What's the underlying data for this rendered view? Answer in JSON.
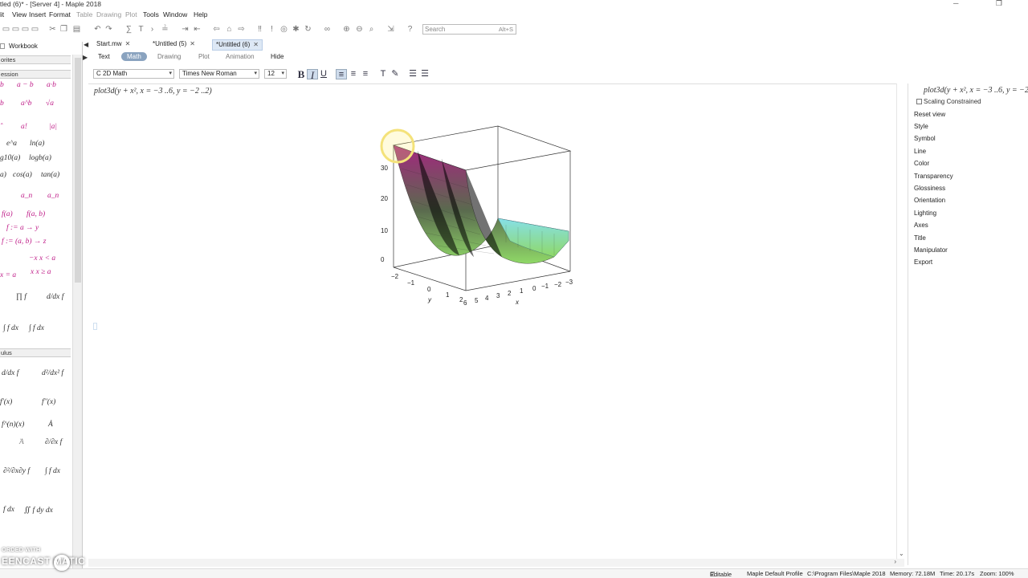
{
  "window": {
    "title": "itled (6)* - [Server 4] - Maple 2018",
    "buttons": [
      "minimize",
      "restore"
    ]
  },
  "menu": [
    "lit",
    "View",
    "Insert",
    "Format",
    "Table",
    "Drawing",
    "Plot",
    "Tools",
    "Window",
    "Help"
  ],
  "search": {
    "placeholder": "Search",
    "shortcut": "Alt+S"
  },
  "left_panel": {
    "tabs": [
      "Workbook"
    ],
    "sections": {
      "favorites": "orites",
      "expression": "ession",
      "calculus": "ulus"
    },
    "palette": {
      "r1": [
        "b",
        "a − b",
        "a·b"
      ],
      "r2": [
        "b",
        "a^b",
        "√a"
      ],
      "r3": [
        "ˆ",
        "a!",
        "|a|"
      ],
      "r4": [
        "e^a",
        "ln(a)"
      ],
      "r5": [
        "g10(a)",
        "logb(a)"
      ],
      "r6": [
        "a)",
        "cos(a)",
        "tan(a)"
      ],
      "r7": [
        "a_n",
        "a_n"
      ],
      "r8": [
        "f(a)",
        "f(a, b)"
      ],
      "r9": [
        "f := a → y"
      ],
      "r10": [
        "f := (a, b) → z"
      ],
      "r11": [
        "−x  x < a",
        "x  x ≥ a",
        "x = a"
      ],
      "r12": [
        "∏ f",
        "d/dx f"
      ],
      "r13": [
        "∫ f dx",
        "∫ f dx"
      ],
      "c1": [
        "d/dx f",
        "d²/dx² f"
      ],
      "c2": [
        "f′(x)",
        "f′′(x)"
      ],
      "c3": [
        "f^(n)(x)",
        "Ȧ"
      ],
      "c4": [
        "̈A",
        "∂/∂x f"
      ],
      "c5": [
        "∂²/∂x∂y f",
        "∫ f dx"
      ],
      "c6": [
        "f dx",
        "∬ f dy dx"
      ]
    }
  },
  "doc_tabs": [
    {
      "label": "Start.mw"
    },
    {
      "label": "*Untitled (5)"
    },
    {
      "label": "*Untitled (6)"
    }
  ],
  "context_bar": {
    "text": "Text",
    "math": "Math",
    "drawing": "Drawing",
    "plot": "Plot",
    "animation": "Animation",
    "hide": "Hide"
  },
  "format_bar": {
    "mode": "2D Math",
    "font": "Times New Roman",
    "size": "12"
  },
  "document": {
    "command": "plot3d(y + x², x = −3 ..6, y = −2 ..2)"
  },
  "chart_data": {
    "type": "surface3d",
    "function": "y + x^2",
    "x_range": [
      -3,
      6
    ],
    "y_range": [
      -2,
      2
    ],
    "z_ticks": [
      "0",
      "10",
      "20",
      "30"
    ],
    "x_ticks": [
      "6",
      "5",
      "4",
      "3",
      "2",
      "1",
      "0",
      "−1",
      "−2",
      "−3"
    ],
    "y_ticks": [
      "−2",
      "−1",
      "0",
      "1",
      "2"
    ],
    "xlabel": "x",
    "ylabel": "y",
    "colors": {
      "high": "#a4267f",
      "mid": "#5a6a4e",
      "low": "#8fd867",
      "cyan": "#86e0e8"
    }
  },
  "right_panel": {
    "command": "plot3d(y + x², x = −3 ..6, y = −2",
    "scaling": "Scaling Constrained",
    "items": [
      "Reset view",
      "Style",
      "Symbol",
      "Line",
      "Color",
      "Transparency",
      "Glossiness",
      "Orientation",
      "Lighting",
      "Axes",
      "Title",
      "Manipulator",
      "Export"
    ]
  },
  "status_bar": {
    "editable": "Editable",
    "profile": "Maple Default Profile",
    "path": "C:\\Program Files\\Maple 2018",
    "memory": "Memory: 72.18M",
    "time": "Time: 20.17s",
    "zoom": "Zoom: 100%"
  },
  "watermark": {
    "line1": "ORDED WITH",
    "line2": "EENCAST MATIC"
  }
}
